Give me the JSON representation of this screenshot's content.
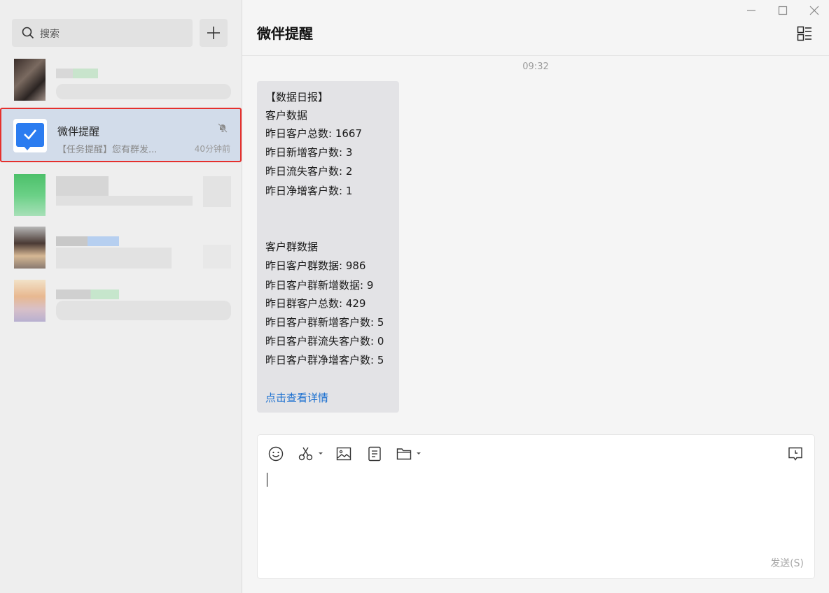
{
  "sidebar": {
    "search_placeholder": "搜索",
    "active_conversation": {
      "name": "微伴提醒",
      "preview": "【任务提醒】您有群发...",
      "time": "40分钟前"
    }
  },
  "chat": {
    "title": "微伴提醒",
    "timestamp": "09:32",
    "message": {
      "lines": [
        "【数据日报】",
        "客户数据",
        "昨日客户总数: 1667",
        "昨日新增客户数: 3",
        "昨日流失客户数: 2",
        "昨日净增客户数: 1",
        "客户群数据",
        "昨日客户群数据: 986",
        "昨日客户群新增数据: 9",
        "昨日群客户总数: 429",
        "昨日客户群新增客户数: 5",
        "昨日客户群流失客户数: 0",
        "昨日客户群净增客户数: 5"
      ],
      "link": "点击查看详情"
    }
  },
  "composer": {
    "send_label": "发送(S)",
    "tool_icons": [
      "emoji-icon",
      "scissors-icon",
      "image-icon",
      "document-icon",
      "folder-icon",
      "history-icon"
    ]
  },
  "colors": {
    "accent": "#2b7cf0",
    "highlight_border": "#e5302d",
    "active_row": "#d2dcea",
    "link": "#1a6fd0"
  }
}
